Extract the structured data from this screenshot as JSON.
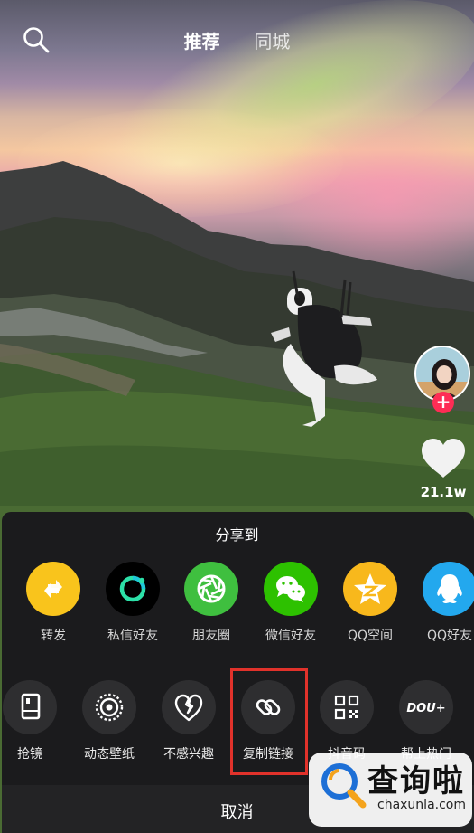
{
  "nav": {
    "tab_recommend": "推荐",
    "tab_local": "同城"
  },
  "rail": {
    "like_count": "21.1w"
  },
  "share": {
    "title": "分享到",
    "row1": [
      {
        "label": "转发",
        "icon": "repost-icon",
        "color": "#f9c41c"
      },
      {
        "label": "私信好友",
        "icon": "message-friend-icon",
        "color": "#000000"
      },
      {
        "label": "朋友圈",
        "icon": "moments-icon",
        "color": "#3fbf3f"
      },
      {
        "label": "微信好友",
        "icon": "wechat-icon",
        "color": "#2dc100"
      },
      {
        "label": "QQ空间",
        "icon": "qzone-icon",
        "color": "#f8b81c"
      },
      {
        "label": "QQ好友",
        "icon": "qq-icon",
        "color": "#23a8ee"
      }
    ],
    "row2": [
      {
        "label": "抢镜",
        "icon": "duet-icon"
      },
      {
        "label": "动态壁纸",
        "icon": "live-wallpaper-icon"
      },
      {
        "label": "不感兴趣",
        "icon": "broken-heart-icon"
      },
      {
        "label": "复制链接",
        "icon": "link-icon"
      },
      {
        "label": "抖音码",
        "icon": "qr-code-icon"
      },
      {
        "label": "帮上热门",
        "icon": "dou-plus-icon"
      }
    ],
    "dou_plus_text": "DOU+",
    "cancel": "取消"
  },
  "watermark": {
    "cn": "查询啦",
    "en": "chaxunla.com"
  }
}
